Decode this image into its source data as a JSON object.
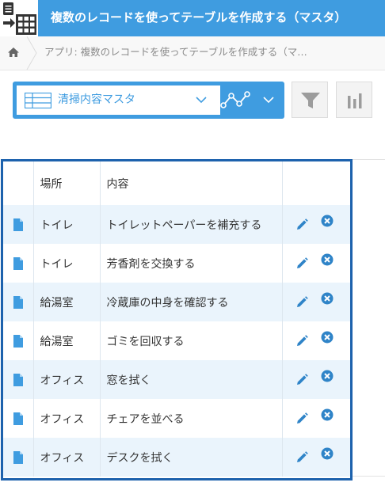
{
  "header": {
    "title": "複数のレコードを使ってテーブルを作成する（マスタ）",
    "icon": "app-table-icon",
    "color": "#3f9ce0"
  },
  "breadcrumb": {
    "home_icon": "home-icon",
    "text": "アプリ: 複数のレコードを使ってテーブルを作成する（マ…"
  },
  "toolbar": {
    "view_name": "清掃内容マスタ",
    "graph_icon": "graph-icon",
    "filter_icon": "filter-icon",
    "chart_icon": "bar-chart-icon"
  },
  "table": {
    "columns": [
      "",
      "場所",
      "内容",
      ""
    ],
    "rows": [
      {
        "place": "トイレ",
        "content": "トイレットペーパーを補充する"
      },
      {
        "place": "トイレ",
        "content": "芳香剤を交換する"
      },
      {
        "place": "給湯室",
        "content": "冷蔵庫の中身を確認する"
      },
      {
        "place": "給湯室",
        "content": "ゴミを回収する"
      },
      {
        "place": "オフィス",
        "content": "窓を拭く"
      },
      {
        "place": "オフィス",
        "content": "チェアを並べる"
      },
      {
        "place": "オフィス",
        "content": "デスクを拭く"
      }
    ],
    "row_colors": {
      "odd": "#eaf4fc",
      "even": "#ffffff",
      "border": "#1d62ad"
    }
  }
}
